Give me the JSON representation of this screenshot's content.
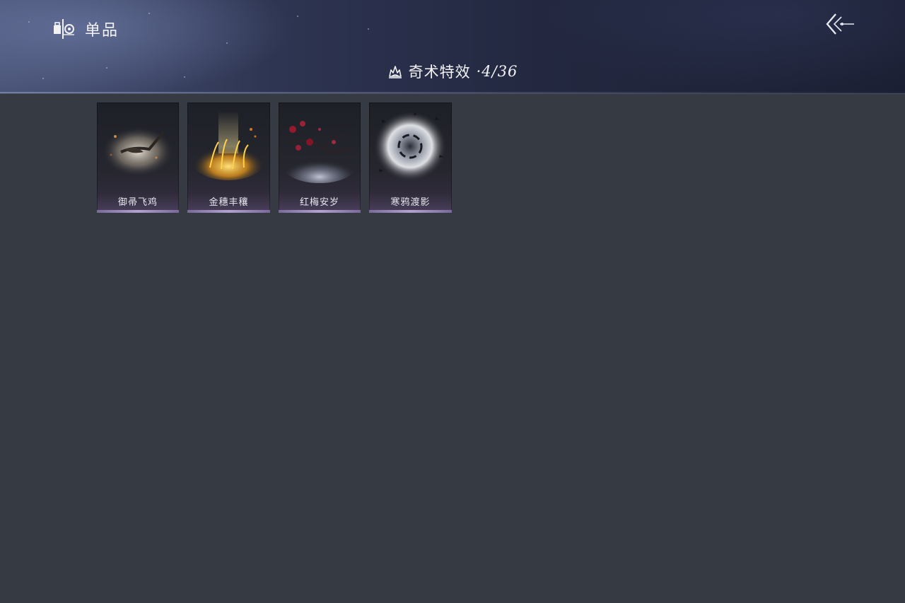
{
  "header": {
    "title": "单品",
    "logo_icon": "collection-emblem-icon",
    "back_icon": "double-chevron-back-icon"
  },
  "section": {
    "title": "奇术特效",
    "count": "·4/36",
    "icon": "flame-crown-icon"
  },
  "items": [
    {
      "name": "御帚飞鸡",
      "icon": "broom-flying-effect-icon",
      "accent": "#d8cbb8"
    },
    {
      "name": "金穗丰穰",
      "icon": "golden-wheat-effect-icon",
      "accent": "#f2a826"
    },
    {
      "name": "红梅安岁",
      "icon": "red-plum-blossom-effect-icon",
      "accent": "#b3213a"
    },
    {
      "name": "寒鸦渡影",
      "icon": "crow-vortex-effect-icon",
      "accent": "#e6e8ec"
    }
  ],
  "colors": {
    "background": "#363a43",
    "header_dark": "#1b1f33",
    "card_accent": "#b3a2cf"
  }
}
